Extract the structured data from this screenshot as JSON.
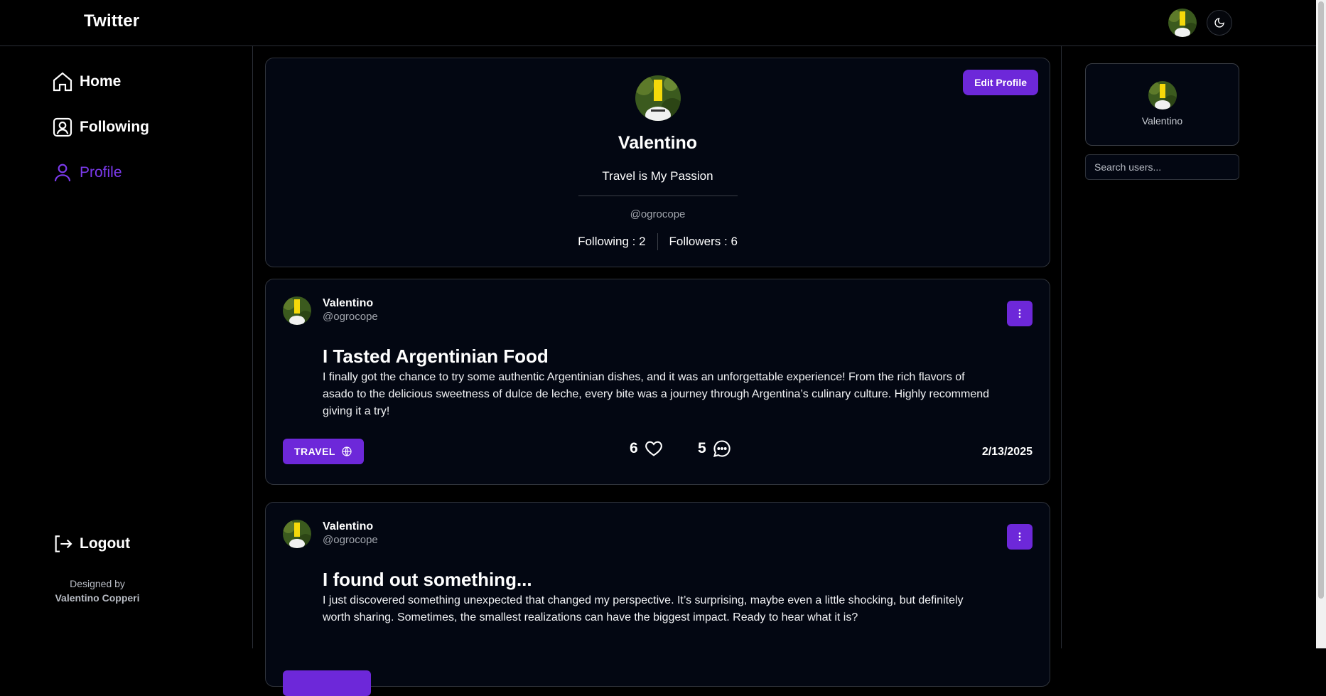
{
  "app": {
    "title": "Twitter"
  },
  "nav": {
    "home": "Home",
    "following": "Following",
    "profile": "Profile",
    "logout": "Logout"
  },
  "credits": {
    "line1": "Designed by",
    "author": "Valentino Copperi"
  },
  "profile": {
    "edit_label": "Edit Profile",
    "name": "Valentino",
    "bio": "Travel is My Passion",
    "handle": "@ogrocope",
    "following": "Following : 2",
    "followers": "Followers : 6"
  },
  "posts": [
    {
      "name": "Valentino",
      "handle": "@ogrocope",
      "title": "I Tasted Argentinian Food",
      "body": "I finally got the chance to try some authentic Argentinian dishes, and it was an unforgettable experience! From the rich flavors of asado to the delicious sweetness of dulce de leche, every bite was a journey through Argentina’s culinary culture. Highly recommend giving it a try!",
      "tag": "TRAVEL",
      "likes": "6",
      "comments": "5",
      "date": "2/13/2025"
    },
    {
      "name": "Valentino",
      "handle": "@ogrocope",
      "title": "I found out something...",
      "body": "I just discovered something unexpected that changed my perspective. It’s surprising, maybe even a little shocking, but definitely worth sharing. Sometimes, the smallest realizations can have the biggest impact. Ready to hear what it is?"
    }
  ],
  "suggested_user": {
    "name": "Valentino"
  },
  "search": {
    "placeholder": "Search users..."
  },
  "colors": {
    "accent": "#6d28d9",
    "active_nav": "#7c3aed",
    "card_bg": "#030712"
  },
  "icons": [
    "home-icon",
    "following-icon",
    "profile-icon",
    "logout-icon",
    "moon-icon",
    "more-vertical-icon",
    "globe-icon",
    "heart-icon",
    "comment-icon"
  ]
}
